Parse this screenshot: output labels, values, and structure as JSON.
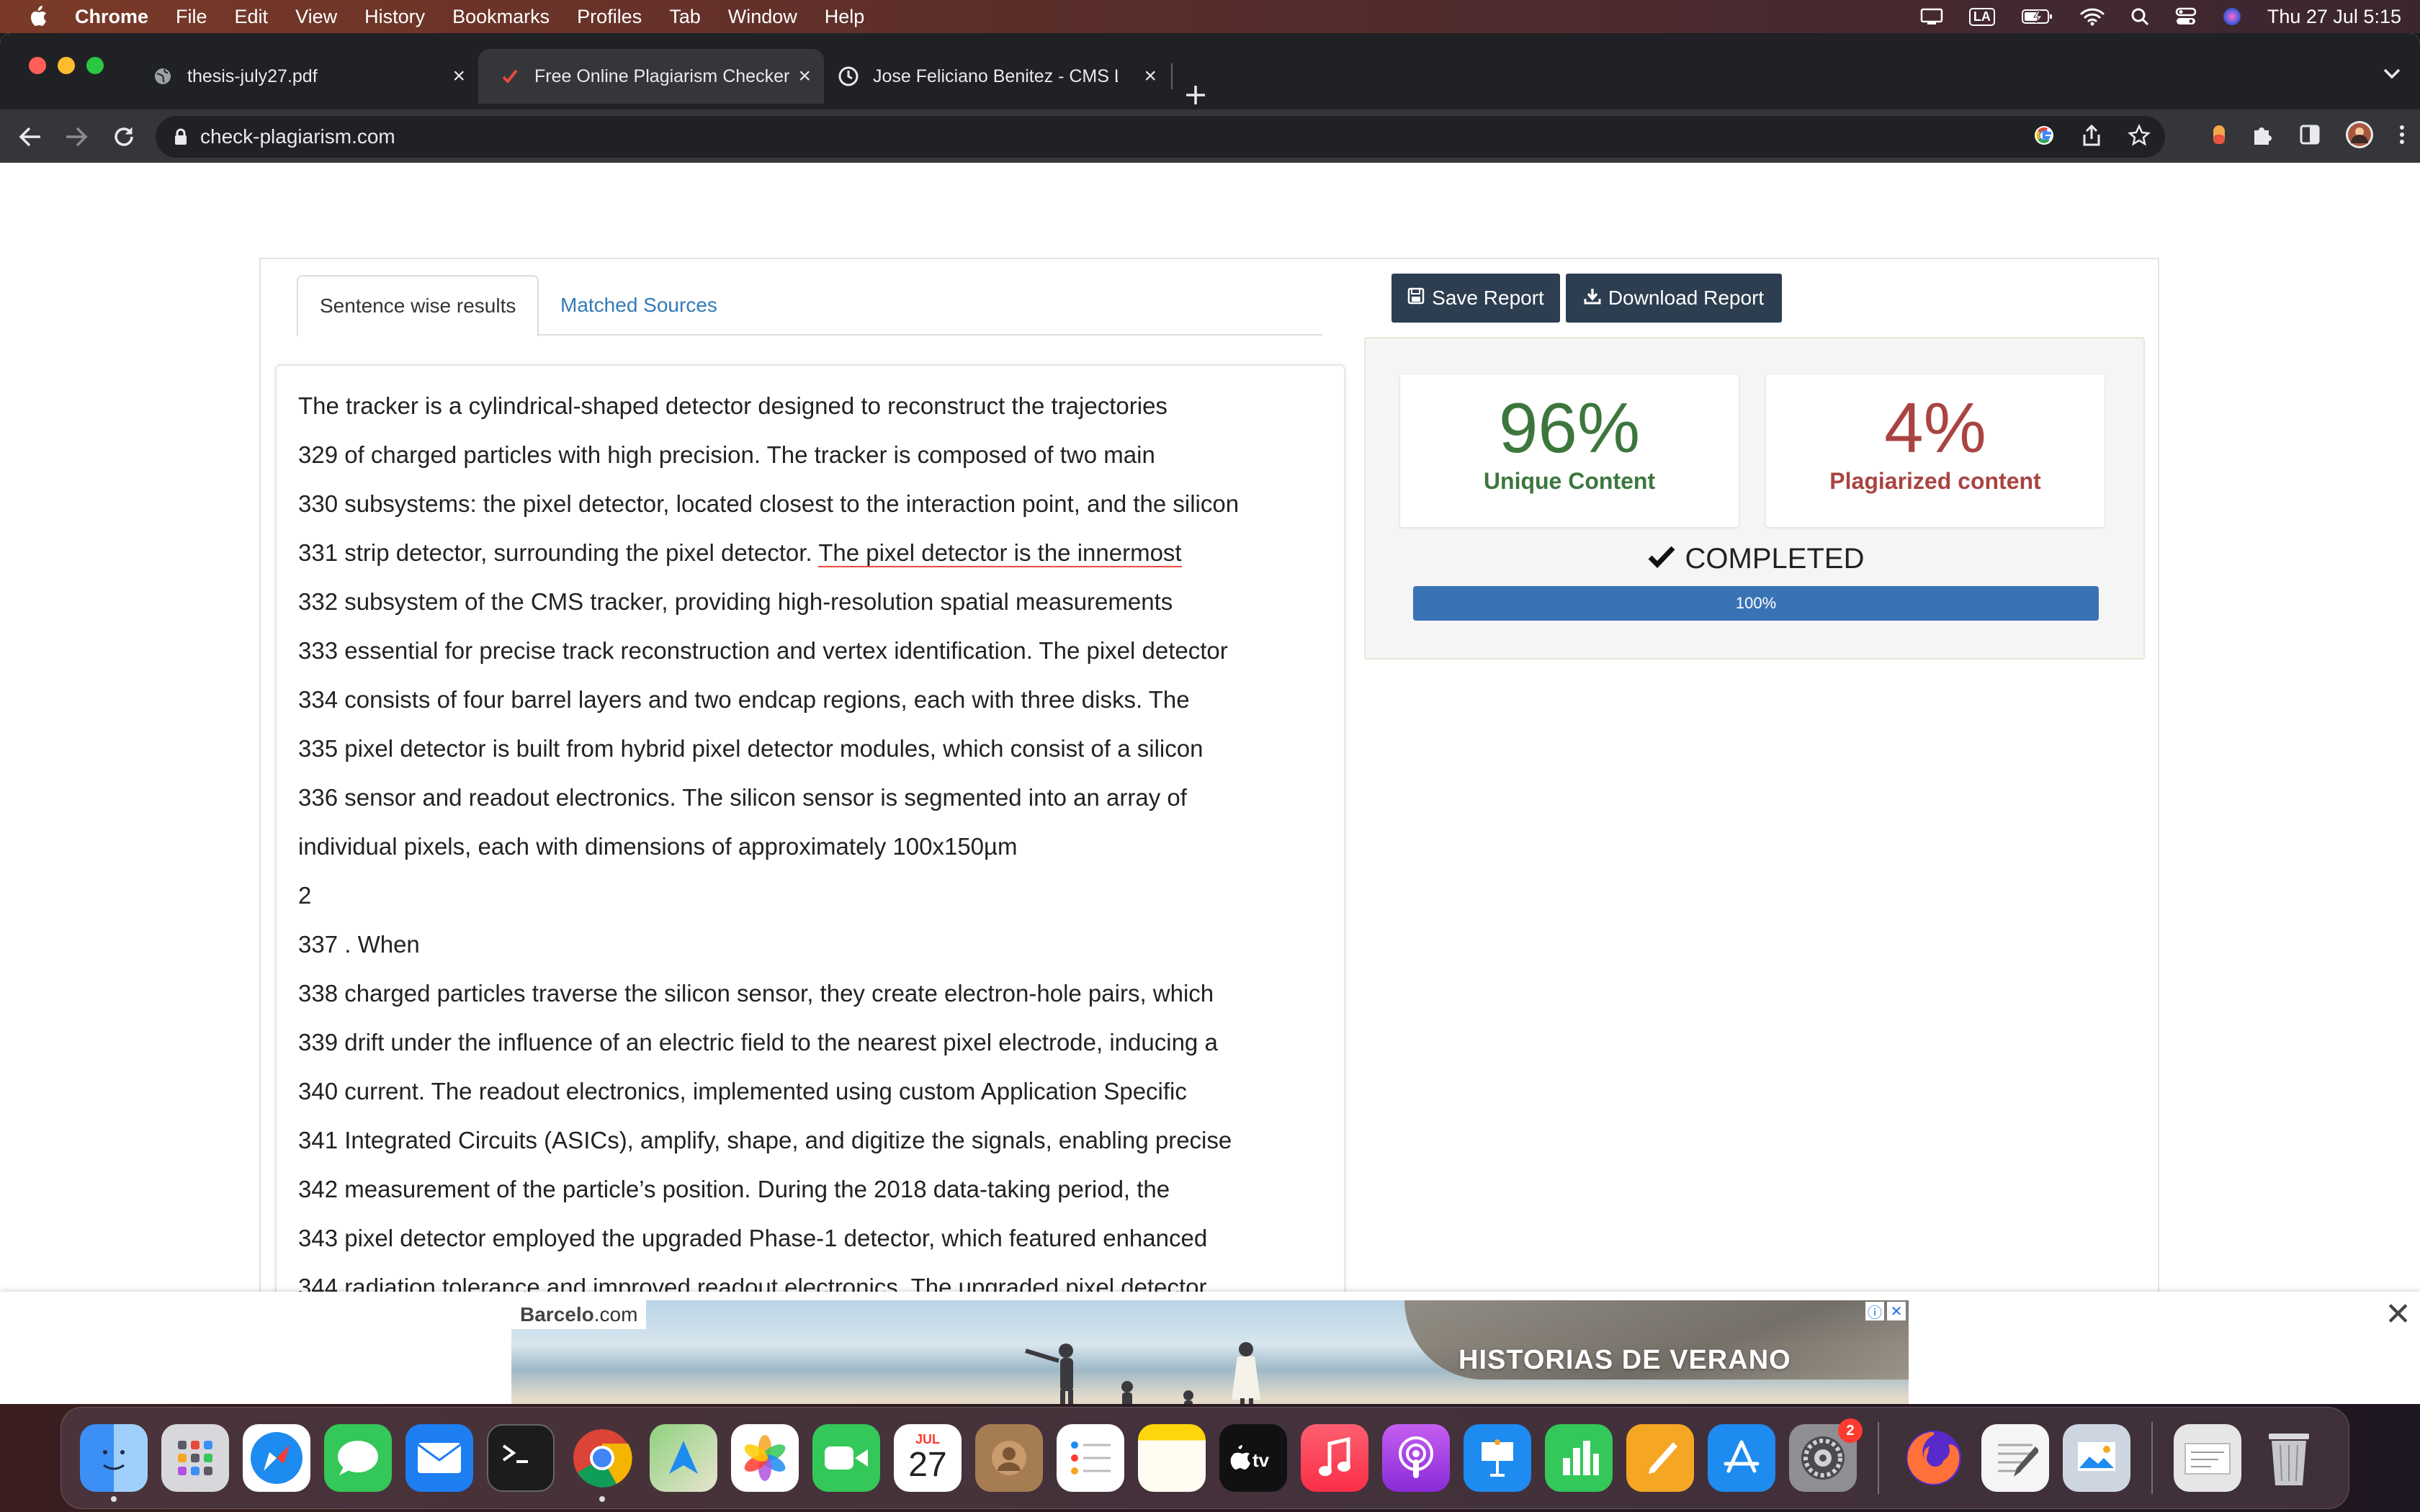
{
  "menubar": {
    "app": "Chrome",
    "items": [
      "File",
      "Edit",
      "View",
      "History",
      "Bookmarks",
      "Profiles",
      "Tab",
      "Window",
      "Help"
    ],
    "input_source": "LA",
    "clock": "Thu 27 Jul  5:15"
  },
  "browser": {
    "tabs": [
      {
        "title": "thesis-july27.pdf",
        "favicon": "globe-icon"
      },
      {
        "title": "Free Online Plagiarism Checker",
        "favicon": "check-icon"
      },
      {
        "title": "Jose Feliciano Benitez - CMS L",
        "favicon": "clock-icon"
      }
    ],
    "active_tab": 1,
    "url": "check-plagiarism.com"
  },
  "page": {
    "tabs": {
      "sentence": "Sentence wise results",
      "sources": "Matched Sources"
    },
    "buttons": {
      "save": "Save Report",
      "download": "Download Report"
    },
    "lines": [
      "The tracker is a cylindrical-shaped detector designed to reconstruct the trajectories",
      "329 of charged particles with high precision. The tracker is composed of two main",
      "330 subsystems: the pixel detector, located closest to the interaction point, and the silicon",
      "331 strip detector, surrounding the pixel detector. ",
      "332 subsystem of the CMS tracker, providing high-resolution spatial measurements",
      "333 essential for precise track reconstruction and vertex identification. The pixel detector",
      "334 consists of four barrel layers and two endcap regions, each with three disks. The",
      "335 pixel detector is built from hybrid pixel detector modules, which consist of a silicon",
      "336 sensor and readout electronics. The silicon sensor is segmented into an array of",
      "individual pixels, each with dimensions of approximately 100x150µm",
      "2",
      "337 . When",
      "338 charged particles traverse the silicon sensor, they create electron-hole pairs, which",
      "339 drift under the influence of an electric field to the nearest pixel electrode, inducing a",
      "340 current. The readout electronics, implemented using custom Application Specific",
      "341 Integrated Circuits (ASICs), amplify, shape, and digitize the signals, enabling precise",
      "342 measurement of the particle’s position. During the 2018 data-taking period, the",
      "343 pixel detector employed the upgraded Phase-1 detector, which featured enhanced",
      "344 radiation tolerance and improved readout electronics. The upgraded pixel detector"
    ],
    "highlighted": "The pixel detector is the innermost",
    "results": {
      "unique_pct": "96%",
      "unique_label": "Unique Content",
      "plag_pct": "4%",
      "plag_label": "Plagiarized content",
      "status": "COMPLETED",
      "progress": 100,
      "progress_label": "100%"
    }
  },
  "ad": {
    "brand": "Barcelo",
    "brand_suffix": ".com",
    "headline": "HISTORIAS DE VERANO"
  },
  "dock": {
    "calendar_month": "JUL",
    "calendar_day": "27",
    "settings_badge": "2",
    "apps": [
      "Finder",
      "Launchpad",
      "Safari",
      "Messages",
      "Mail",
      "Terminal",
      "Chrome",
      "Maps",
      "Photos",
      "FaceTime",
      "Calendar",
      "Contacts",
      "Reminders",
      "Notes",
      "TV",
      "Music",
      "Podcasts",
      "Keynote",
      "Numbers",
      "Pages",
      "App Store",
      "System Settings",
      "Firefox",
      "TextEdit",
      "Preview",
      "Downloads",
      "Trash"
    ]
  },
  "colors": {
    "unique": "#3c763d",
    "plagiarized": "#a94442",
    "button": "#2c3e50",
    "progress": "#3a73b5",
    "link": "#337ab7"
  }
}
